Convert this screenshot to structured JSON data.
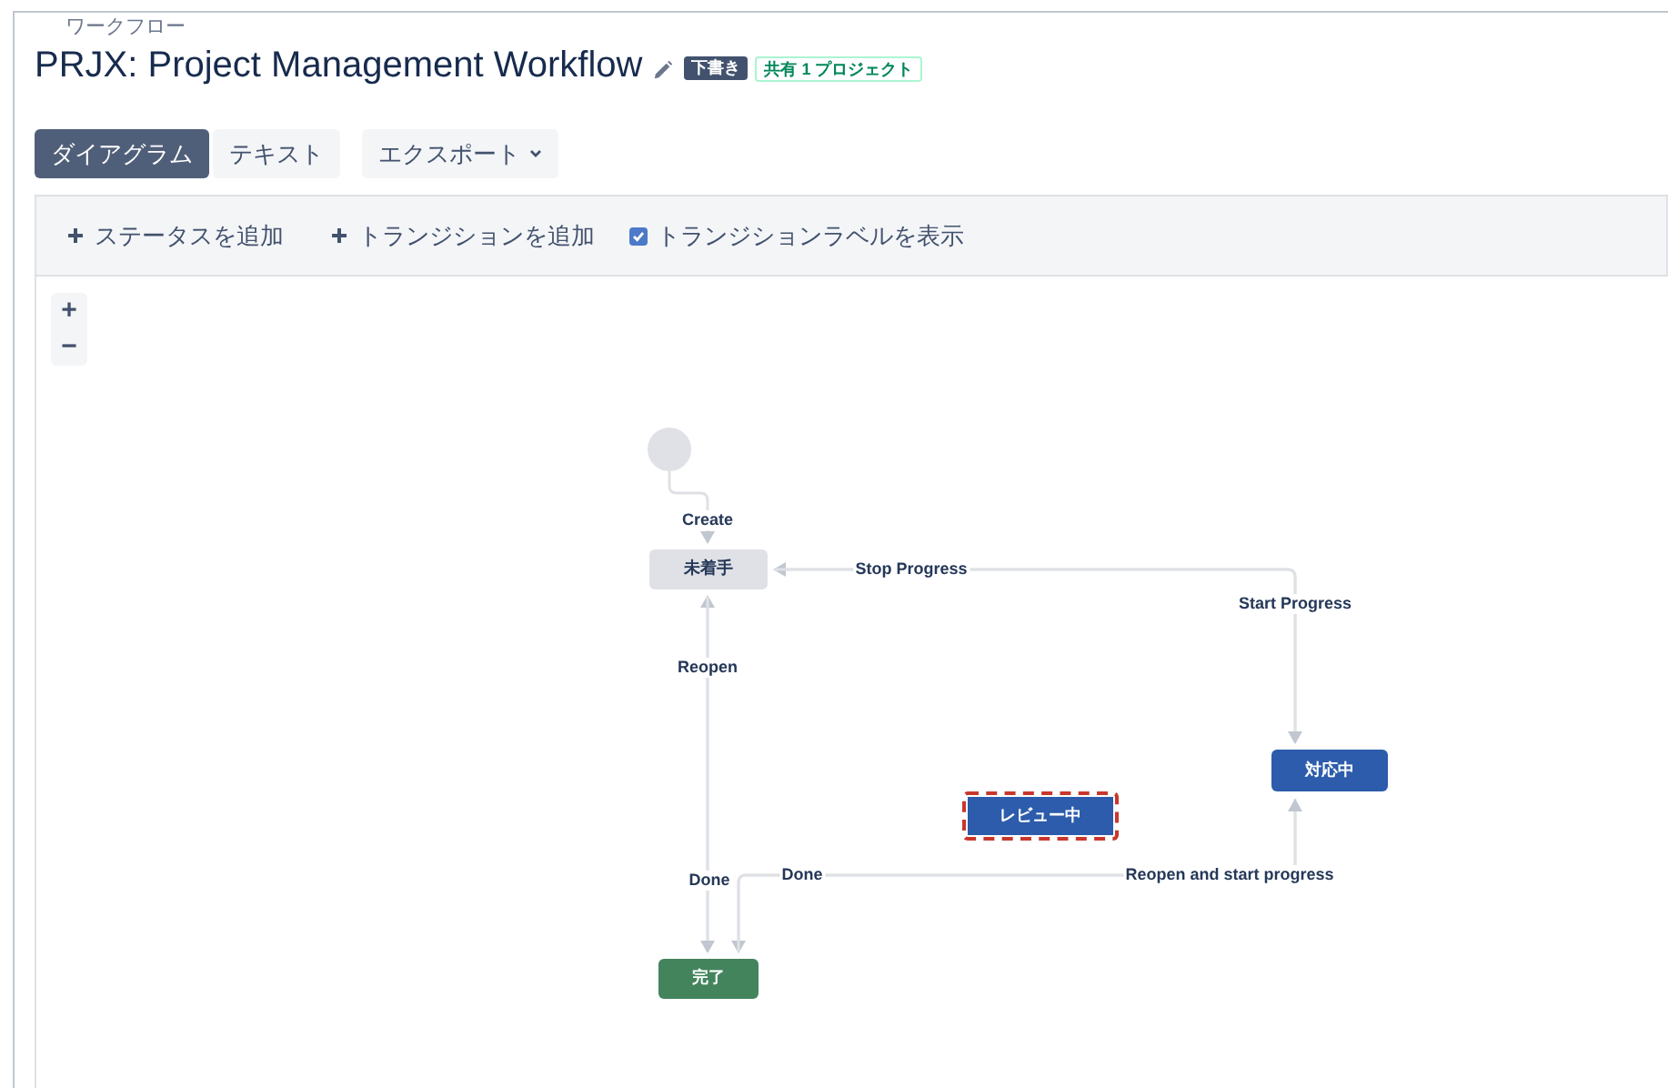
{
  "breadcrumb": "ワークフロー",
  "title": "PRJX: Project Management Workflow",
  "badges": [
    {
      "kind": "status",
      "label": "下書き"
    },
    {
      "kind": "shared",
      "label": "共有 1 プロジェクト"
    }
  ],
  "tabs": [
    {
      "label": "ダイアグラム",
      "selected": true
    },
    {
      "label": "テキスト",
      "selected": false
    }
  ],
  "export_menu": {
    "label": "エクスポート"
  },
  "toolbar": {
    "add_status": "ステータスを追加",
    "add_transition": "トランジションを追加",
    "show_labels": {
      "label": "トランジションラベルを表示",
      "checked": true
    }
  },
  "zoom": {
    "in": "+",
    "out": "−"
  },
  "diagram": {
    "nodes": [
      {
        "kind": "start"
      },
      {
        "kind": "todo",
        "label": "未着手",
        "selected": false
      },
      {
        "kind": "inprogress",
        "label": "対応中",
        "selected": false
      },
      {
        "kind": "inprogress",
        "label": "レビュー中",
        "selected": true
      },
      {
        "kind": "done",
        "label": "完了",
        "selected": false
      }
    ],
    "transitions": [
      {
        "label": "Create"
      },
      {
        "label": "Stop Progress"
      },
      {
        "label": "Start Progress"
      },
      {
        "label": "Reopen"
      },
      {
        "label": "Done"
      },
      {
        "label": "Done"
      },
      {
        "label": "Reopen and start progress"
      }
    ]
  }
}
